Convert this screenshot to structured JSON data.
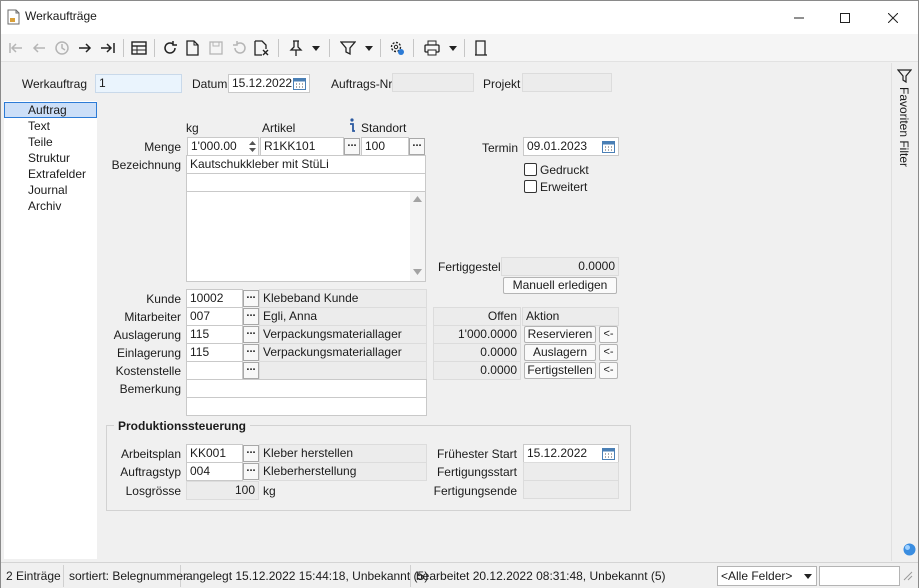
{
  "window": {
    "title": "Werkaufträge",
    "controls": {
      "minimize": "minimize-icon",
      "maximize": "maximize-icon",
      "close": "close-icon"
    }
  },
  "toolbar": {
    "icons": [
      "first-icon",
      "previous-icon",
      "history-icon",
      "next-icon",
      "last-icon",
      "table-icon",
      "refresh-icon",
      "new-document-icon",
      "save-icon",
      "undo-icon",
      "delete-document-icon",
      "pin-icon",
      "filter-icon",
      "settings-icon",
      "print-icon",
      "exit-icon"
    ]
  },
  "header": {
    "werkauftrag_label": "Werkauftrag",
    "werkauftrag_value": "1",
    "datum_label": "Datum",
    "datum_value": "15.12.2022",
    "auftragsnr_label": "Auftrags-Nr.",
    "auftragsnr_value": "",
    "projekt_label": "Projekt",
    "projekt_value": ""
  },
  "nav": {
    "items": [
      "Auftrag",
      "Text",
      "Teile",
      "Struktur",
      "Extrafelder",
      "Journal",
      "Archiv"
    ],
    "selected": "Auftrag"
  },
  "form": {
    "unit_header": "kg",
    "artikel_header": "Artikel",
    "standort_header": "Standort",
    "menge_label": "Menge",
    "menge_value": "1'000.00",
    "artikel_value": "R1KK101",
    "standort_value": "100",
    "termin_label": "Termin",
    "termin_value": "09.01.2023",
    "bezeichnung_label": "Bezeichnung",
    "bezeichnung_value": "Kautschukkleber mit StüLi",
    "bezeichnung_line2": "",
    "description_text": "",
    "gedruckt_label": "Gedruckt",
    "erweitert_label": "Erweitert",
    "fertiggestellt_label": "Fertiggestellt",
    "fertiggestellt_value": "0.0000",
    "manuell_button": "Manuell erledigen",
    "kunde_label": "Kunde",
    "kunde_value": "10002",
    "kunde_name": "Klebeband Kunde",
    "mitarbeiter_label": "Mitarbeiter",
    "mitarbeiter_value": "007",
    "mitarbeiter_name": "Egli, Anna",
    "auslagerung_label": "Auslagerung",
    "auslagerung_value": "115",
    "auslagerung_name": "Verpackungsmateriallager",
    "einlagerung_label": "Einlagerung",
    "einlagerung_value": "115",
    "einlagerung_name": "Verpackungsmateriallager",
    "kostenstelle_label": "Kostenstelle",
    "kostenstelle_value": "",
    "kostenstelle_name": "",
    "bemerkung_label": "Bemerkung",
    "bemerkung_value": "",
    "bemerkung_line2": ""
  },
  "actions": {
    "offen_header": "Offen",
    "aktion_header": "Aktion",
    "rows": [
      {
        "offen": "1'000.0000",
        "button": "Reservieren",
        "arrow": "<-"
      },
      {
        "offen": "0.0000",
        "button": "Auslagern",
        "arrow": "<-"
      },
      {
        "offen": "0.0000",
        "button": "Fertigstellen",
        "arrow": "<-"
      }
    ]
  },
  "produktion": {
    "title": "Produktionssteuerung",
    "arbeitsplan_label": "Arbeitsplan",
    "arbeitsplan_value": "KK001",
    "arbeitsplan_name": "Kleber herstellen",
    "auftragstyp_label": "Auftragstyp",
    "auftragstyp_value": "004",
    "auftragstyp_name": "Kleberherstellung",
    "losgroesse_label": "Losgrösse",
    "losgroesse_value": "100",
    "losgroesse_unit": "kg",
    "fruehester_start_label": "Frühester Start",
    "fruehester_start_value": "15.12.2022",
    "fertigungsstart_label": "Fertigungsstart",
    "fertigungsstart_value": "",
    "fertigungsende_label": "Fertigungsende",
    "fertigungsende_value": ""
  },
  "sidebar_right": {
    "label": "Favoriten Filter"
  },
  "status": {
    "count": "2 Einträge",
    "sort": "sortiert: Belegnummer",
    "created": "angelegt 15.12.2022 15:44:18, Unbekannt (5)",
    "edited": "bearbeitet 20.12.2022 08:31:48, Unbekannt (5)",
    "fields_select": "<Alle Felder>",
    "search_value": ""
  },
  "colors": {
    "accent": "#2c7bd6",
    "selected_bg": "#ccdff8",
    "highlight_field": "#eaf4fd"
  }
}
